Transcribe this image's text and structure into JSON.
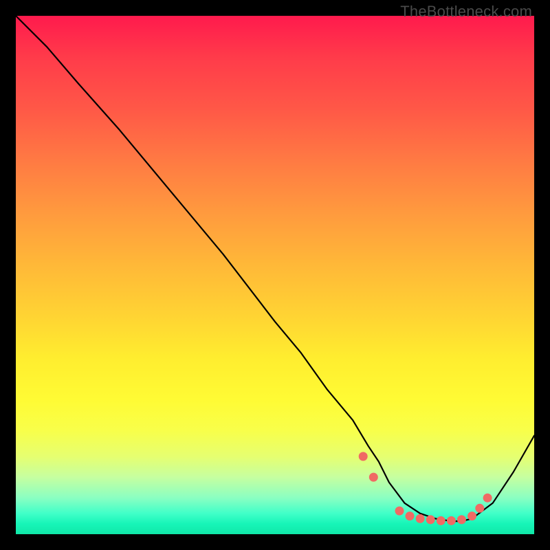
{
  "watermark": "TheBottleneck.com",
  "chart_data": {
    "type": "line",
    "title": "",
    "xlabel": "",
    "ylabel": "",
    "xlim": [
      0,
      100
    ],
    "ylim": [
      0,
      100
    ],
    "grid": false,
    "legend": false,
    "series": [
      {
        "name": "curve",
        "x": [
          0,
          6,
          12,
          20,
          30,
          40,
          50,
          55,
          60,
          65,
          68,
          70,
          72,
          75,
          78,
          81,
          84,
          86,
          88,
          92,
          96,
          100
        ],
        "y": [
          100,
          94,
          87,
          78,
          66,
          54,
          41,
          35,
          28,
          22,
          17,
          14,
          10,
          6,
          4,
          3,
          2.5,
          2.5,
          3,
          6,
          12,
          19
        ]
      }
    ],
    "markers": [
      {
        "x": 67,
        "y": 15
      },
      {
        "x": 69,
        "y": 11
      },
      {
        "x": 74,
        "y": 4.5
      },
      {
        "x": 76,
        "y": 3.5
      },
      {
        "x": 78,
        "y": 3
      },
      {
        "x": 80,
        "y": 2.8
      },
      {
        "x": 82,
        "y": 2.6
      },
      {
        "x": 84,
        "y": 2.6
      },
      {
        "x": 86,
        "y": 2.8
      },
      {
        "x": 88,
        "y": 3.5
      },
      {
        "x": 89.5,
        "y": 5
      },
      {
        "x": 91,
        "y": 7
      }
    ],
    "gradient_stops": [
      {
        "pos": 0,
        "color": "#ff1a4d"
      },
      {
        "pos": 50,
        "color": "#ffc836"
      },
      {
        "pos": 75,
        "color": "#fffb34"
      },
      {
        "pos": 100,
        "color": "#10e8a8"
      }
    ]
  }
}
